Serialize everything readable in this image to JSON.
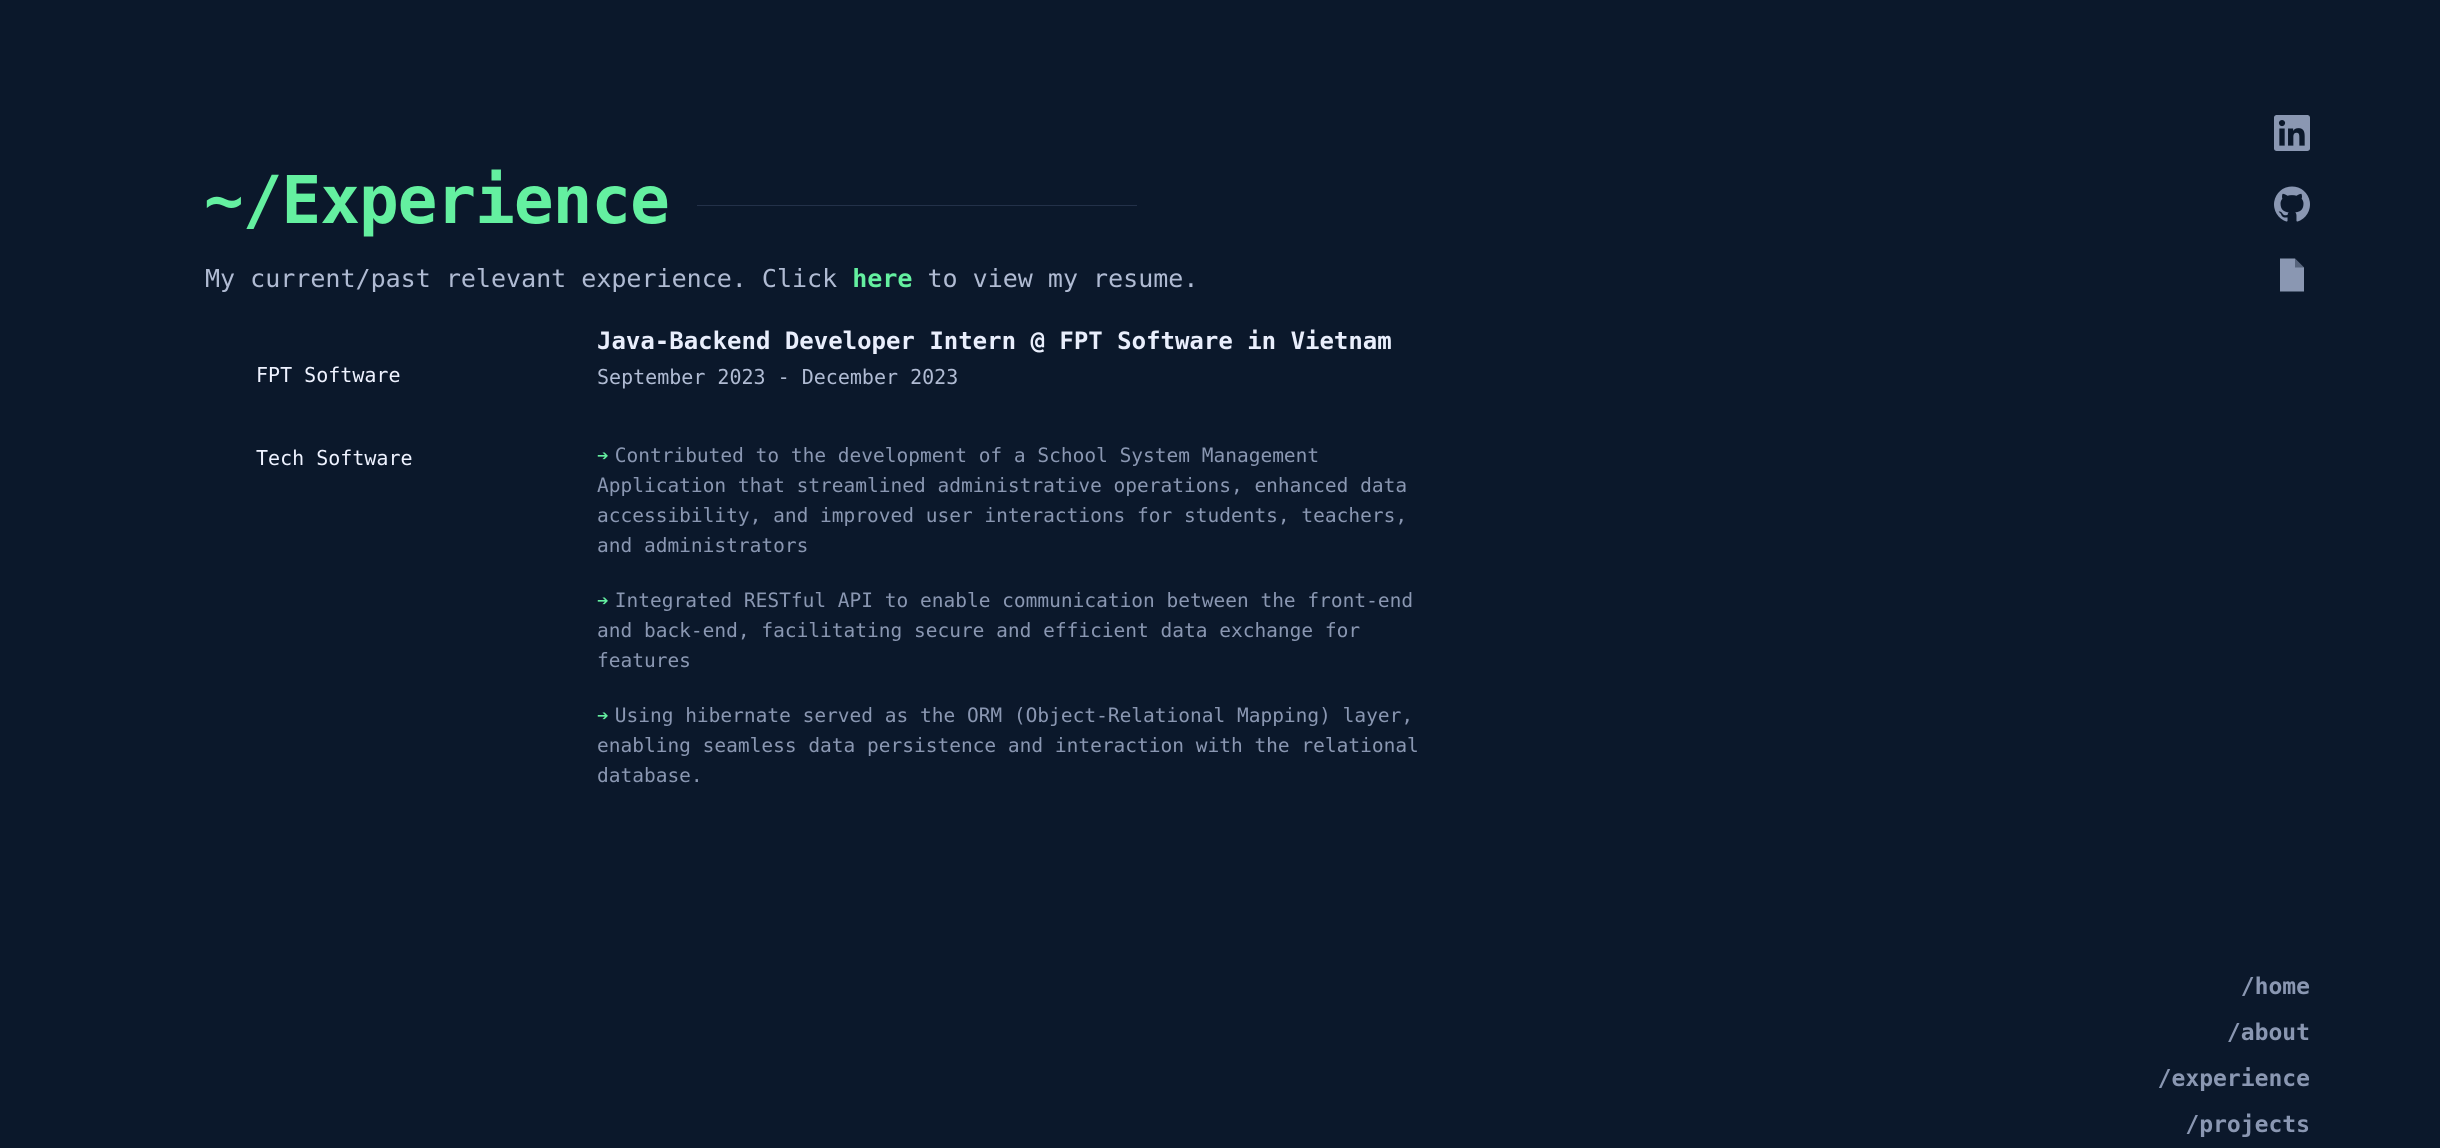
{
  "header": {
    "title": "~/Experience",
    "subtitle_before": "My current/past relevant experience. Click ",
    "subtitle_link": "here",
    "subtitle_after": " to view my resume."
  },
  "companies": [
    {
      "label": "FPT Software"
    },
    {
      "label": "Tech Software"
    }
  ],
  "job": {
    "title": "Java-Backend Developer Intern @ FPT Software in Vietnam",
    "date": "September 2023 - December 2023",
    "bullet_marker": "➔",
    "bullets": [
      "Contributed to the development of a School System Management Application that streamlined administrative operations, enhanced data accessibility, and improved user interactions for students, teachers, and administrators",
      "Integrated RESTful API to enable communication between the front-end and back-end, facilitating secure and efficient data exchange for features",
      "Using hibernate served as the ORM (Object-Relational Mapping) layer, enabling seamless data persistence and interaction with the relational database."
    ]
  },
  "social": [
    {
      "icon": "linkedin-icon"
    },
    {
      "icon": "github-icon"
    },
    {
      "icon": "document-icon"
    }
  ],
  "nav": [
    {
      "label": "/home"
    },
    {
      "label": "/about"
    },
    {
      "label": "/experience"
    },
    {
      "label": "/projects"
    }
  ],
  "colors": {
    "background": "#0b182b",
    "accent": "#64f0a0",
    "muted": "#8a97b2",
    "text": "#eef2ff"
  }
}
